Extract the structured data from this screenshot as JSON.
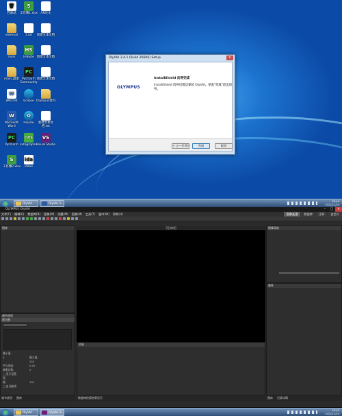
{
  "desktop": {
    "icons": [
      {
        "label": "回收站",
        "glyph": "🗑",
        "kind": "white"
      },
      {
        "label": "工作簿1.xlsx",
        "glyph": "S",
        "kind": "green"
      },
      {
        "label": "AN论文",
        "glyph": "",
        "kind": "doc"
      },
      {
        "label": "external",
        "glyph": "",
        "kind": "folder"
      },
      {
        "label": "1.txt",
        "glyph": "",
        "kind": "doc"
      },
      {
        "label": "新建文本文档",
        "glyph": "",
        "kind": "doc"
      },
      {
        "label": "main",
        "glyph": "",
        "kind": "folder"
      },
      {
        "label": "HiSuite",
        "glyph": "HS",
        "kind": "green"
      },
      {
        "label": "新建文本文档",
        "glyph": "",
        "kind": "doc"
      },
      {
        "label": "main_副本",
        "glyph": "",
        "kind": "folder"
      },
      {
        "label": "PyCharm Community",
        "glyph": "PC",
        "kind": "pc"
      },
      {
        "label": "新建文本文档",
        "glyph": "",
        "kind": "doc"
      },
      {
        "label": "WeChat",
        "glyph": "W",
        "kind": "doc"
      },
      {
        "label": "Eclipse",
        "glyph": "",
        "kind": "circle"
      },
      {
        "label": "Olympus资料",
        "glyph": "",
        "kind": "folder"
      },
      {
        "label": "Microsoft Word",
        "glyph": "W",
        "kind": "blue"
      },
      {
        "label": "Hisuite",
        "glyph": "✿",
        "kind": "circle"
      },
      {
        "label": "新建文本文档.txt",
        "glyph": "",
        "kind": "doc"
      },
      {
        "label": "PyCharm",
        "glyph": "PC",
        "kind": "pc"
      },
      {
        "label": "cutegraphic",
        "glyph": "CUTE",
        "kind": "cute"
      },
      {
        "label": "Visual Studio",
        "glyph": "VS",
        "kind": "vs"
      },
      {
        "label": "工作簿2.xlsx",
        "glyph": "S",
        "kind": "green"
      },
      {
        "label": "idaxx",
        "glyph": "ida",
        "kind": "white"
      }
    ]
  },
  "installer": {
    "title": "OlyVIA 3.4.1 (Build 26606) Setup",
    "logo": "OLYMPUS",
    "heading": "InstallShield 向导完成",
    "message": "InstallShield 向导已成功安装 OlyVIA。单击\"完成\"退出向导。",
    "back_label": "< 上一步(B)",
    "finish_label": "完成",
    "cancel_label": "取消",
    "close_glyph": "x"
  },
  "taskbar_top": {
    "buttons": [
      "OlyVIA",
      "OlyVIA 3..."
    ],
    "tray": "CH",
    "time": "23:44",
    "date": "2021/11/24"
  },
  "app": {
    "title": "OLYMPUS OlyVIA",
    "menu": [
      "文件(F)",
      "编辑(E)",
      "数据库(B)",
      "图像(M)",
      "测量(M)",
      "图像(M)",
      "工具(T)",
      "窗口(W)",
      "帮助(H)"
    ],
    "workspace_tabs": [
      {
        "label": "图像处理",
        "active": true
      },
      {
        "label": "数据库",
        "active": false
      },
      {
        "label": "注释",
        "active": false
      },
      {
        "label": "自定义",
        "active": false
      }
    ],
    "left_top_header": "图库",
    "image_header": "[无文档]",
    "right_top_header": "图像导航",
    "right_bottom_header": "属性",
    "left_bottom_header": "调节选项",
    "histogram_title": "直方图",
    "stats": [
      {
        "label": "最小值:",
        "value": ""
      },
      {
        "label": "0",
        "value": "最大值:"
      },
      {
        "label": "",
        "value": "255"
      },
      {
        "label": "平均亮度:",
        "value": "0.00"
      },
      {
        "label": "像素总数:",
        "value": "0"
      },
      {
        "label": "□ 显示设置",
        "value": ""
      },
      {
        "label": "亮:",
        "value": ""
      },
      {
        "label": "暗:",
        "value": "100"
      },
      {
        "label": "□ 自动曲线",
        "value": ""
      }
    ],
    "bottom_panel_header": "消息",
    "bottom_tabs_left": [
      "调节选项",
      "图库"
    ],
    "bottom_tabs_center": [
      "数据库检索结果显示"
    ],
    "bottom_tabs_right": [
      "图库",
      "记录详情"
    ]
  },
  "taskbar_bottom": {
    "buttons": [
      "OlyVIA",
      "OlyVIA 3..."
    ],
    "tray": "CH",
    "time": "23:45",
    "date": "2021/11/24"
  },
  "colors": {
    "desktop": "#1c73cf",
    "app_bg": "#2b2b2b",
    "accent": "#3c7fb1",
    "close": "#c43c3c"
  }
}
